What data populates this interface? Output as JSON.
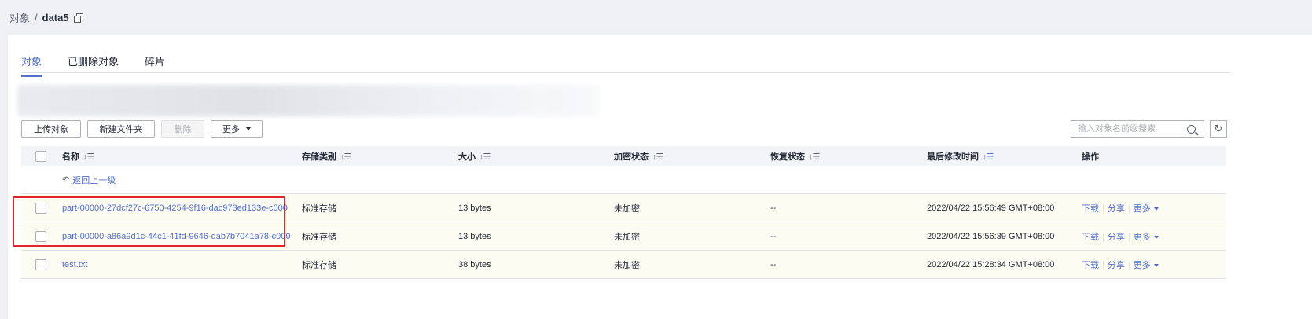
{
  "breadcrumb": {
    "root": "对象",
    "sep": "/",
    "current": "data5"
  },
  "tabs": [
    {
      "label": "对象",
      "active": true
    },
    {
      "label": "已删除对象",
      "active": false
    },
    {
      "label": "碎片",
      "active": false
    }
  ],
  "toolbar": {
    "upload": "上传对象",
    "new_folder": "新建文件夹",
    "delete": "删除",
    "more": "更多"
  },
  "search": {
    "placeholder": "输入对象名前缀搜索"
  },
  "table": {
    "headers": [
      "名称",
      "存储类别",
      "大小",
      "加密状态",
      "恢复状态",
      "最后修改时间",
      "操作"
    ],
    "back_label": "返回上一级",
    "rows": [
      {
        "name": "part-00000-27dcf27c-6750-4254-9f16-dac973ed133e-c000",
        "storage": "标准存储",
        "size": "13 bytes",
        "encryption": "未加密",
        "restore": "--",
        "modified": "2022/04/22 15:56:49 GMT+08:00"
      },
      {
        "name": "part-00000-a86a9d1c-44c1-41fd-9646-dab7b7041a78-c000",
        "storage": "标准存储",
        "size": "13 bytes",
        "encryption": "未加密",
        "restore": "--",
        "modified": "2022/04/22 15:56:39 GMT+08:00"
      },
      {
        "name": "test.txt",
        "storage": "标准存储",
        "size": "38 bytes",
        "encryption": "未加密",
        "restore": "--",
        "modified": "2022/04/22 15:28:34 GMT+08:00"
      }
    ],
    "ops": {
      "download": "下载",
      "share": "分享",
      "more": "更多"
    }
  },
  "colors": {
    "accent": "#526ecc",
    "highlight_border": "#e3242b",
    "row_highlight": "#fdfcf3"
  }
}
